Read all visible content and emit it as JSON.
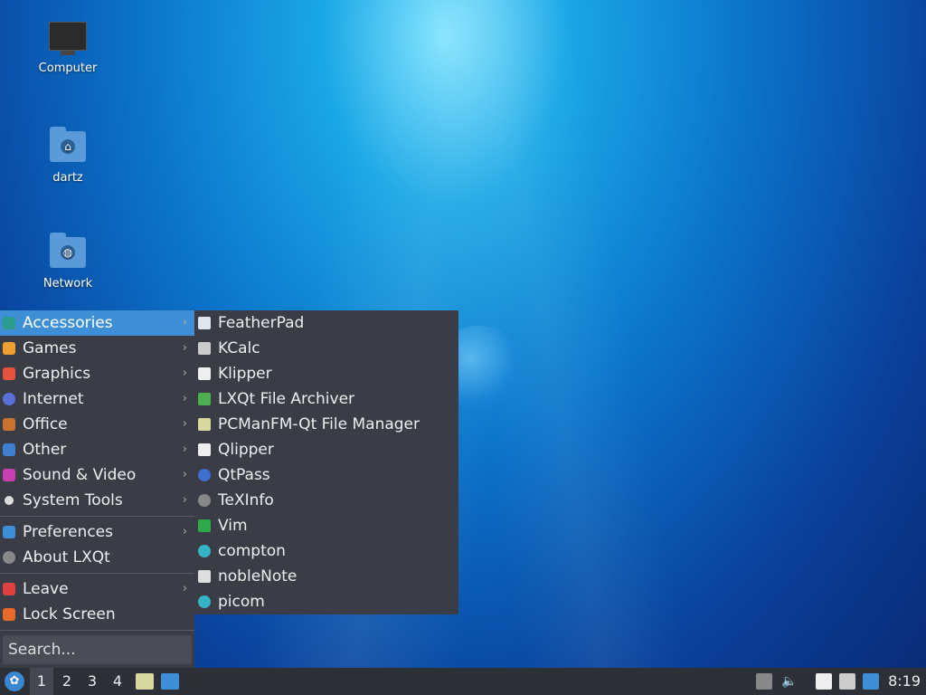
{
  "desktop": {
    "icons": [
      {
        "label": "Computer",
        "icon": "computer-icon"
      },
      {
        "label": "dartz",
        "icon": "home-folder-icon"
      },
      {
        "label": "Network",
        "icon": "network-folder-icon"
      }
    ]
  },
  "menu": {
    "categories": [
      {
        "label": "Accessories",
        "icon": "accessories-icon",
        "color": "#2a9d8f",
        "active": true
      },
      {
        "label": "Games",
        "icon": "games-icon",
        "color": "#f0a030"
      },
      {
        "label": "Graphics",
        "icon": "graphics-icon",
        "color": "#e5533d"
      },
      {
        "label": "Internet",
        "icon": "internet-icon",
        "color": "#5a6fd8"
      },
      {
        "label": "Office",
        "icon": "office-icon",
        "color": "#c9732f"
      },
      {
        "label": "Other",
        "icon": "other-icon",
        "color": "#3f7fd0"
      },
      {
        "label": "Sound & Video",
        "icon": "sound-video-icon",
        "color": "#c93fb0"
      },
      {
        "label": "System Tools",
        "icon": "system-tools-icon",
        "color": "#dddddd"
      }
    ],
    "preferences": {
      "label": "Preferences",
      "icon": "preferences-icon",
      "color": "#3f8fd6"
    },
    "about": {
      "label": "About LXQt",
      "icon": "info-icon",
      "color": "#888888"
    },
    "leave": {
      "label": "Leave",
      "icon": "power-icon",
      "color": "#e04040"
    },
    "lock": {
      "label": "Lock Screen",
      "icon": "lock-icon",
      "color": "#e86a2a"
    },
    "search_placeholder": "Search..."
  },
  "submenu": {
    "items": [
      {
        "label": "FeatherPad",
        "icon": "featherpad-icon",
        "color": "#dfe6ee"
      },
      {
        "label": "KCalc",
        "icon": "kcalc-icon",
        "color": "#cccccc"
      },
      {
        "label": "Klipper",
        "icon": "klipper-icon",
        "color": "#eeeeee"
      },
      {
        "label": "LXQt File Archiver",
        "icon": "archiver-icon",
        "color": "#4caf50"
      },
      {
        "label": "PCManFM-Qt File Manager",
        "icon": "file-manager-icon",
        "color": "#d7d7a0"
      },
      {
        "label": "Qlipper",
        "icon": "qlipper-icon",
        "color": "#eeeeee"
      },
      {
        "label": "QtPass",
        "icon": "qtpass-icon",
        "color": "#3f6fd0"
      },
      {
        "label": "TeXInfo",
        "icon": "texinfo-icon",
        "color": "#888888"
      },
      {
        "label": "Vim",
        "icon": "vim-icon",
        "color": "#2eaa4a"
      },
      {
        "label": "compton",
        "icon": "compton-icon",
        "color": "#36b3c5"
      },
      {
        "label": "nobleNote",
        "icon": "noblenote-icon",
        "color": "#dddddd"
      },
      {
        "label": "picom",
        "icon": "picom-icon",
        "color": "#36b3c5"
      }
    ]
  },
  "taskbar": {
    "workspaces": [
      "1",
      "2",
      "3",
      "4"
    ],
    "active_workspace": "1",
    "clock": "8:19"
  }
}
